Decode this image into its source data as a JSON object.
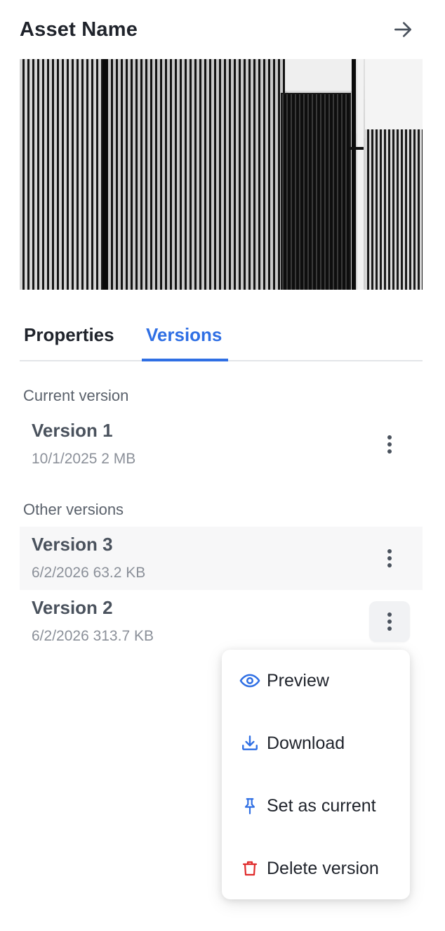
{
  "header": {
    "title": "Asset Name",
    "next_icon": "arrow-right-icon"
  },
  "preview": {
    "description_icon": "asset-preview-image"
  },
  "tabs": [
    {
      "label": "Properties",
      "active": false
    },
    {
      "label": "Versions",
      "active": true
    }
  ],
  "current_section": {
    "label": "Current version",
    "versions": [
      {
        "name": "Version 1",
        "meta": "10/1/2025 2 MB"
      }
    ]
  },
  "other_section": {
    "label": "Other versions",
    "versions": [
      {
        "name": "Version 3",
        "meta": "6/2/2026 63.2 KB"
      },
      {
        "name": "Version 2",
        "meta": "6/2/2026 313.7 KB"
      }
    ]
  },
  "menu": {
    "items": [
      {
        "label": "Preview",
        "icon": "eye-icon"
      },
      {
        "label": "Download",
        "icon": "download-icon"
      },
      {
        "label": "Set as current",
        "icon": "pin-icon"
      },
      {
        "label": "Delete version",
        "icon": "trash-icon"
      }
    ]
  },
  "colors": {
    "accent": "#2f6fe4",
    "danger": "#e02b2b",
    "text_primary": "#1f232b",
    "text_muted": "#8b9099"
  }
}
